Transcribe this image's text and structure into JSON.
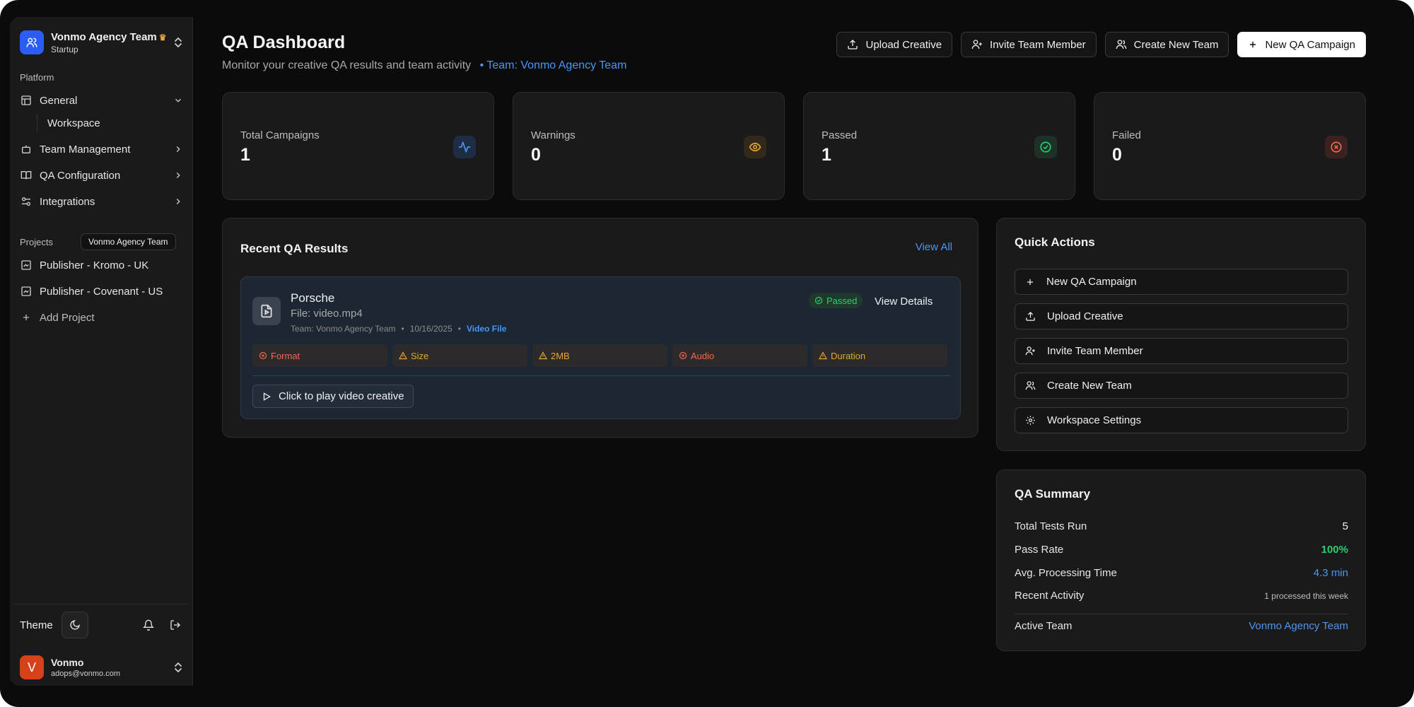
{
  "colors": {
    "accent_blue": "#4c95f0",
    "success_green": "#2ecc71",
    "warning_amber": "#e8a530",
    "error_red": "#f06a4c",
    "team_logo_bg": "#2a5cf6",
    "avatar_bg": "#d5421a"
  },
  "sidebar": {
    "team": {
      "name": "Vonmo Agency Team",
      "crown_icon": "crown-icon",
      "plan": "Startup"
    },
    "platform_label": "Platform",
    "nav": [
      {
        "label": "General",
        "icon": "layout-icon"
      },
      {
        "label": "Team Management",
        "icon": "bot-icon"
      },
      {
        "label": "QA Configuration",
        "icon": "book-icon"
      },
      {
        "label": "Integrations",
        "icon": "sliders-icon"
      }
    ],
    "general_sub": {
      "workspace": "Workspace"
    },
    "projects_label": "Projects",
    "projects_badge": "Vonmo Agency Team",
    "projects": [
      {
        "label": "Publisher - Kromo - UK"
      },
      {
        "label": "Publisher - Covenant - US"
      }
    ],
    "add_project": "Add Project",
    "theme_label": "Theme",
    "user": {
      "initial": "V",
      "name": "Vonmo",
      "email": "adops@vonmo.com"
    }
  },
  "header": {
    "title": "QA Dashboard",
    "subtitle": "Monitor your creative QA results and team activity",
    "team_bullet": "•",
    "team_text": "Team: Vonmo Agency Team",
    "actions": {
      "upload": "Upload Creative",
      "invite": "Invite Team Member",
      "create_team": "Create New Team",
      "new_campaign": "New QA Campaign"
    }
  },
  "stats": [
    {
      "label": "Total Campaigns",
      "value": "1",
      "icon": "activity-icon",
      "color": "#4c95f0"
    },
    {
      "label": "Warnings",
      "value": "0",
      "icon": "eye-icon",
      "color": "#e8a530"
    },
    {
      "label": "Passed",
      "value": "1",
      "icon": "check-circle-icon",
      "color": "#2ecc71"
    },
    {
      "label": "Failed",
      "value": "0",
      "icon": "x-circle-icon",
      "color": "#f06a4c"
    }
  ],
  "recent": {
    "title": "Recent QA Results",
    "view_all": "View All",
    "item": {
      "name": "Porsche",
      "file": "File: video.mp4",
      "team": "Team: Vonmo Agency Team",
      "sep": "•",
      "date": "10/16/2025",
      "type": "Video File",
      "status": "Passed",
      "view_details": "View Details",
      "checks": [
        {
          "label": "Format",
          "status": "error"
        },
        {
          "label": "Size",
          "status": "warning"
        },
        {
          "label": "2MB",
          "status": "warning"
        },
        {
          "label": "Audio",
          "status": "error"
        },
        {
          "label": "Duration",
          "status": "warning"
        }
      ],
      "play": "Click to play video creative"
    }
  },
  "quick_actions": {
    "title": "Quick Actions",
    "items": [
      {
        "label": "New QA Campaign",
        "icon": "plus-icon"
      },
      {
        "label": "Upload Creative",
        "icon": "upload-icon"
      },
      {
        "label": "Invite Team Member",
        "icon": "user-plus-icon"
      },
      {
        "label": "Create New Team",
        "icon": "users-icon"
      },
      {
        "label": "Workspace Settings",
        "icon": "gear-icon"
      }
    ]
  },
  "summary": {
    "title": "QA Summary",
    "total_tests_label": "Total Tests Run",
    "total_tests_value": "5",
    "pass_rate_label": "Pass Rate",
    "pass_rate_value": "100%",
    "avg_time_label": "Avg. Processing Time",
    "avg_time_value": "4.3 min",
    "recent_label": "Recent Activity",
    "recent_value": "1 processed this week",
    "active_team_label": "Active Team",
    "active_team_value": "Vonmo Agency Team"
  }
}
